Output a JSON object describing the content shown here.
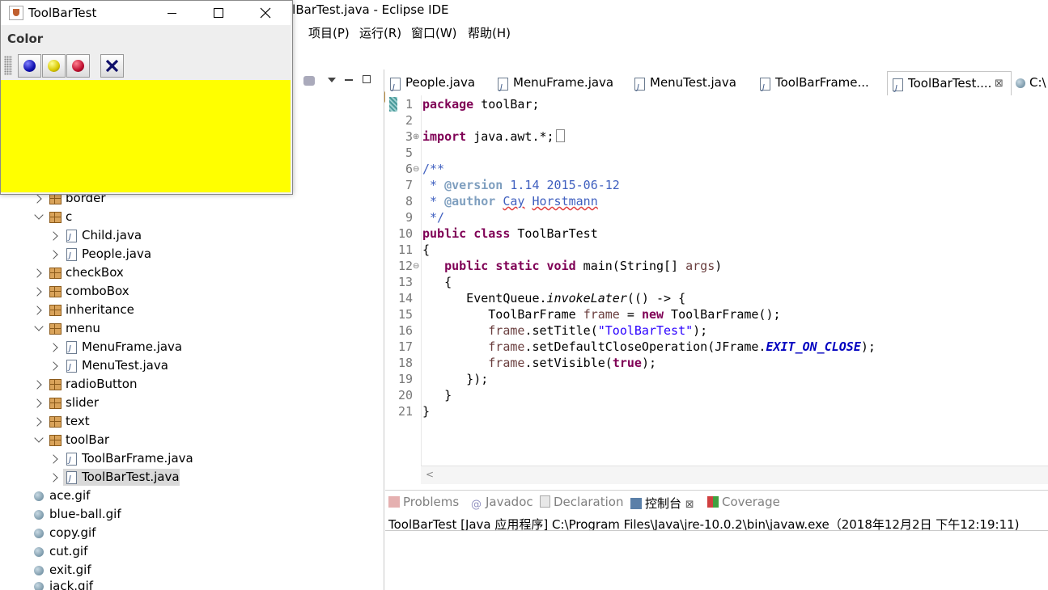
{
  "eclipse": {
    "window_title": "olBarTest.java - Eclipse IDE",
    "menus": [
      "​)",
      "项目(P)",
      "运行(R)",
      "窗口(W)",
      "帮助(H)"
    ]
  },
  "explorer": {
    "items": [
      {
        "label": "border",
        "kind": "package",
        "expanded": false,
        "level": 1
      },
      {
        "label": "c",
        "kind": "package",
        "expanded": true,
        "level": 1
      },
      {
        "label": "Child.java",
        "kind": "java",
        "level": 2
      },
      {
        "label": "People.java",
        "kind": "java",
        "level": 2
      },
      {
        "label": "checkBox",
        "kind": "package",
        "expanded": false,
        "level": 1
      },
      {
        "label": "comboBox",
        "kind": "package",
        "expanded": false,
        "level": 1
      },
      {
        "label": "inheritance",
        "kind": "package",
        "expanded": false,
        "level": 1
      },
      {
        "label": "menu",
        "kind": "package",
        "expanded": true,
        "level": 1
      },
      {
        "label": "MenuFrame.java",
        "kind": "java",
        "level": 2
      },
      {
        "label": "MenuTest.java",
        "kind": "java",
        "level": 2
      },
      {
        "label": "radioButton",
        "kind": "package",
        "expanded": false,
        "level": 1
      },
      {
        "label": "slider",
        "kind": "package",
        "expanded": false,
        "level": 1
      },
      {
        "label": "text",
        "kind": "package",
        "expanded": false,
        "level": 1
      },
      {
        "label": "toolBar",
        "kind": "package",
        "expanded": true,
        "level": 1
      },
      {
        "label": "ToolBarFrame.java",
        "kind": "java",
        "level": 2
      },
      {
        "label": "ToolBarTest.java",
        "kind": "java",
        "level": 2,
        "selected": true
      },
      {
        "label": "ace.gif",
        "kind": "gif",
        "level": 0
      },
      {
        "label": "blue-ball.gif",
        "kind": "gif",
        "level": 0
      },
      {
        "label": "copy.gif",
        "kind": "gif",
        "level": 0
      },
      {
        "label": "cut.gif",
        "kind": "gif",
        "level": 0
      },
      {
        "label": "exit.gif",
        "kind": "gif",
        "level": 0
      },
      {
        "label": "jack.gif",
        "kind": "gif",
        "level": 0
      }
    ]
  },
  "editor_tabs": [
    {
      "label": "People.java"
    },
    {
      "label": "MenuFrame.java"
    },
    {
      "label": "MenuTest.java"
    },
    {
      "label": "ToolBarFrame..."
    },
    {
      "label": "ToolBarTest....",
      "active": true,
      "close": "⊠"
    },
    {
      "label": "C:\\"
    }
  ],
  "code": {
    "line_numbers": [
      "1",
      "2",
      "3",
      "5",
      "6",
      "7",
      "8",
      "9",
      "10",
      "11",
      "12",
      "13",
      "14",
      "15",
      "16",
      "17",
      "18",
      "19",
      "20",
      "21"
    ],
    "l1_kw": "package",
    "l1_rest": " toolBar;",
    "l3_kw": "import",
    "l3_rest": " java.awt.*;",
    "l6": "/**",
    "l7_a": " * ",
    "l7_tag": "@version",
    "l7_b": " 1.14 2015-06-12",
    "l8_a": " * ",
    "l8_tag": "@author",
    "l8_sp": " ",
    "l8_n1": "Cay",
    "l8_sp2": " ",
    "l8_n2": "Horstmann",
    "l9": " */",
    "l10_kw1": "public",
    "l10_kw2": "class",
    "l10_rest": " ToolBarTest",
    "l11": "{",
    "l12_ind": "   ",
    "l12_kw1": "public",
    "l12_kw2": "static",
    "l12_kw3": "void",
    "l12_rest": " main(String[] ",
    "l12_prm": "args",
    "l12_end": ")",
    "l13": "   {",
    "l14_a": "      EventQueue.",
    "l14_ita": "invokeLater",
    "l14_b": "(() -> {",
    "l15_a": "         ToolBarFrame ",
    "l15_var": "frame",
    "l15_b": " = ",
    "l15_kw": "new",
    "l15_c": " ToolBarFrame();",
    "l16_a": "         ",
    "l16_var": "frame",
    "l16_b": ".setTitle(",
    "l16_str": "\"ToolBarTest\"",
    "l16_c": ");",
    "l17_a": "         ",
    "l17_var": "frame",
    "l17_b": ".setDefaultCloseOperation(JFrame.",
    "l17_cst": "EXIT_ON_CLOSE",
    "l17_c": ");",
    "l18_a": "         ",
    "l18_var": "frame",
    "l18_b": ".setVisible(",
    "l18_kw": "true",
    "l18_c": ");",
    "l19": "      });",
    "l20": "   }",
    "l21": "}"
  },
  "console": {
    "tabs": [
      {
        "label": "Problems"
      },
      {
        "label": "Javadoc"
      },
      {
        "label": "Declaration"
      },
      {
        "label": "控制台",
        "active": true,
        "close": "⊠"
      },
      {
        "label": "Coverage"
      }
    ],
    "output": "ToolBarTest [Java 应用程序] C:\\Program Files\\Java\\jre-10.0.2\\bin\\javaw.exe（2018年12月2日 下午12:19:11)"
  },
  "toolbar_window": {
    "title": "ToolBarTest",
    "menu": "Color",
    "buttons": [
      {
        "name": "blue-ball",
        "color": "#1010b0"
      },
      {
        "name": "yellow-ball",
        "color": "#d8c800"
      },
      {
        "name": "red-ball",
        "color": "#c01030"
      },
      {
        "name": "exit",
        "color": "#10106a"
      }
    ],
    "panel_color": "#ffff00"
  }
}
